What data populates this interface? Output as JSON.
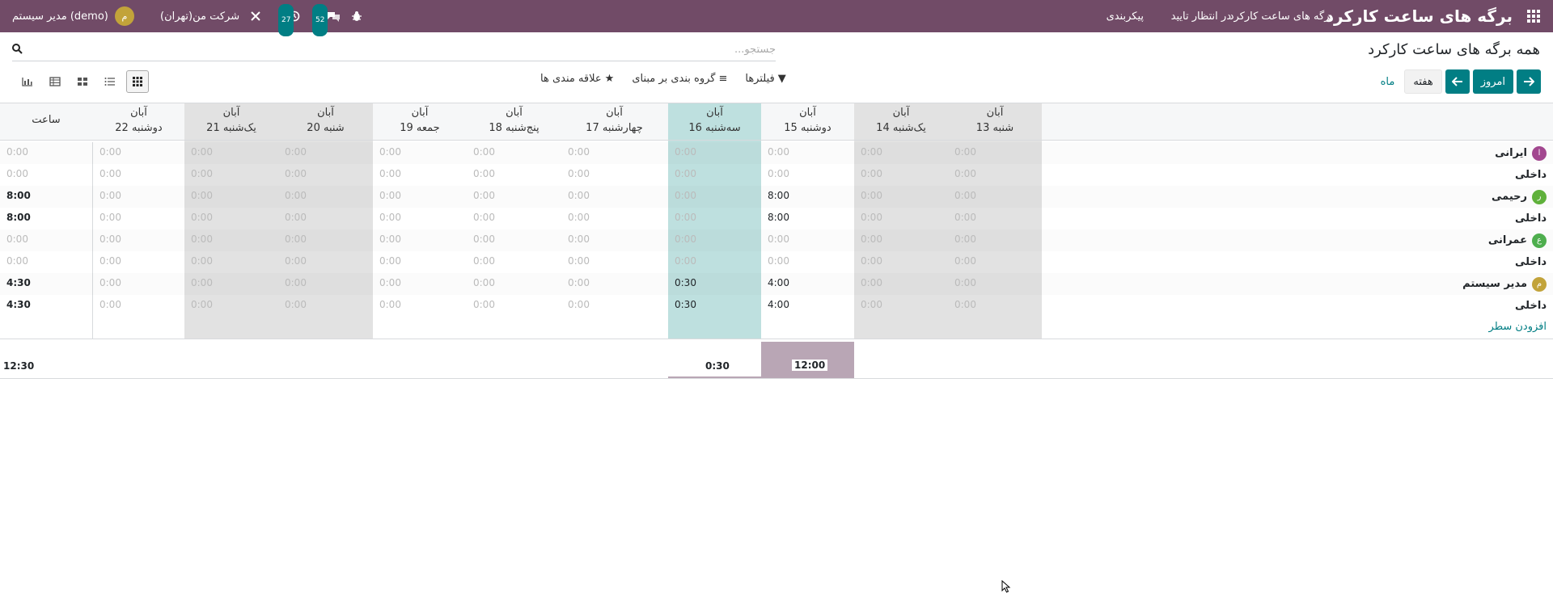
{
  "navbar": {
    "app_title": "برگه های ساعت کارکرد",
    "menu": [
      "برگه های ساعت کارکرد",
      "در انتظار تایید",
      "پیکربندی"
    ],
    "company": "شرکت من(تهران)",
    "user": "مدیر سیستم (demo)",
    "user_initial": "م",
    "badges": {
      "messages": "52",
      "activities": "27"
    },
    "icons": [
      "apps-icon",
      "bug-icon",
      "chat-icon",
      "clock-icon",
      "tools-icon"
    ]
  },
  "control": {
    "page_title": "همه برگه های ساعت کارکرد",
    "search_placeholder": "جستجو...",
    "today": "امروز",
    "week": "هفته",
    "month": "ماه",
    "filters": "فیلترها",
    "group_by": "گروه بندی بر مبنای",
    "favorites": "علاقه مندی ها"
  },
  "grid": {
    "total_header": "ساعت",
    "columns": [
      {
        "month": "آبان",
        "day": "شنبه 13",
        "kind": "weekend"
      },
      {
        "month": "آبان",
        "day": "یک‌شنبه 14",
        "kind": "weekend"
      },
      {
        "month": "آبان",
        "day": "دوشنبه 15",
        "kind": "normal"
      },
      {
        "month": "آبان",
        "day": "سه‌شنبه 16",
        "kind": "today"
      },
      {
        "month": "آبان",
        "day": "چهارشنبه 17",
        "kind": "normal"
      },
      {
        "month": "آبان",
        "day": "پنج‌شنبه 18",
        "kind": "normal"
      },
      {
        "month": "آبان",
        "day": "جمعه 19",
        "kind": "normal"
      },
      {
        "month": "آبان",
        "day": "شنبه 20",
        "kind": "weekend"
      },
      {
        "month": "آبان",
        "day": "یک‌شنبه 21",
        "kind": "weekend"
      },
      {
        "month": "آبان",
        "day": "دوشنبه 22",
        "kind": "normal"
      }
    ],
    "rows": [
      {
        "name": "ایرانی",
        "initial": "ا",
        "avatar_color": "#a2478f",
        "group": true,
        "values": [
          "0:00",
          "0:00",
          "0:00",
          "0:00",
          "0:00",
          "0:00",
          "0:00",
          "0:00",
          "0:00",
          "0:00"
        ],
        "total": "0:00"
      },
      {
        "name": "داخلی",
        "group": false,
        "values": [
          "0:00",
          "0:00",
          "0:00",
          "0:00",
          "0:00",
          "0:00",
          "0:00",
          "0:00",
          "0:00",
          "0:00"
        ],
        "total": "0:00"
      },
      {
        "name": "رحیمی",
        "initial": "ر",
        "avatar_color": "#5fb13b",
        "group": true,
        "values": [
          "0:00",
          "0:00",
          "8:00",
          "0:00",
          "0:00",
          "0:00",
          "0:00",
          "0:00",
          "0:00",
          "0:00"
        ],
        "total": "8:00"
      },
      {
        "name": "داخلی",
        "group": false,
        "values": [
          "0:00",
          "0:00",
          "8:00",
          "0:00",
          "0:00",
          "0:00",
          "0:00",
          "0:00",
          "0:00",
          "0:00"
        ],
        "total": "8:00"
      },
      {
        "name": "عمرانی",
        "initial": "ع",
        "avatar_color": "#4eae4e",
        "group": true,
        "values": [
          "0:00",
          "0:00",
          "0:00",
          "0:00",
          "0:00",
          "0:00",
          "0:00",
          "0:00",
          "0:00",
          "0:00"
        ],
        "total": "0:00"
      },
      {
        "name": "داخلی",
        "group": false,
        "values": [
          "0:00",
          "0:00",
          "0:00",
          "0:00",
          "0:00",
          "0:00",
          "0:00",
          "0:00",
          "0:00",
          "0:00"
        ],
        "total": "0:00"
      },
      {
        "name": "مدیر سیستم",
        "initial": "م",
        "avatar_color": "#c2a33a",
        "group": true,
        "values": [
          "0:00",
          "0:00",
          "4:00",
          "0:30",
          "0:00",
          "0:00",
          "0:00",
          "0:00",
          "0:00",
          "0:00"
        ],
        "total": "4:30"
      },
      {
        "name": "داخلی",
        "group": false,
        "values": [
          "0:00",
          "0:00",
          "4:00",
          "0:30",
          "0:00",
          "0:00",
          "0:00",
          "0:00",
          "0:00",
          "0:00"
        ],
        "total": "4:30"
      }
    ],
    "add_line": "افزودن سطر",
    "totals": {
      "mon15": "12:00",
      "tue16": "0:30",
      "grand": "12:30"
    }
  }
}
